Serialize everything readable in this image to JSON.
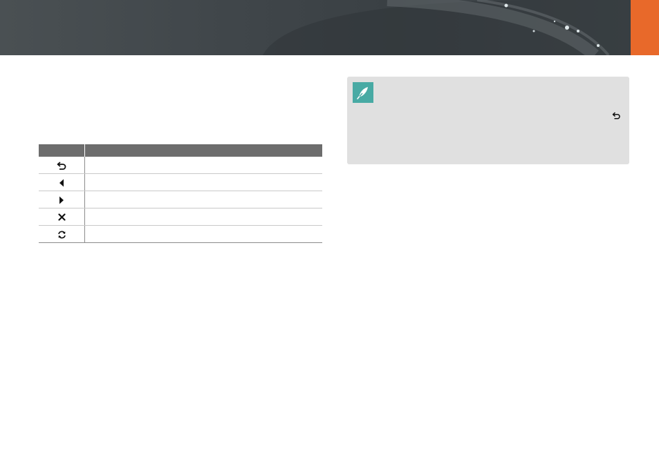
{
  "colors": {
    "banner": "#40464a",
    "accent_orange": "#e8692a",
    "table_header": "#6d6d6d",
    "note_background": "#e0e0e0",
    "note_icon": "#48aaa4"
  },
  "icon_table": {
    "headers": [
      "",
      ""
    ],
    "rows": [
      {
        "icon": "back-arrow-icon",
        "description": ""
      },
      {
        "icon": "left-triangle-icon",
        "description": ""
      },
      {
        "icon": "right-triangle-icon",
        "description": ""
      },
      {
        "icon": "delete-x-icon",
        "description": ""
      },
      {
        "icon": "rotate-icon",
        "description": ""
      }
    ]
  },
  "note": {
    "icon": "pen-nib-icon",
    "inline_icon": "back-arrow-icon"
  }
}
